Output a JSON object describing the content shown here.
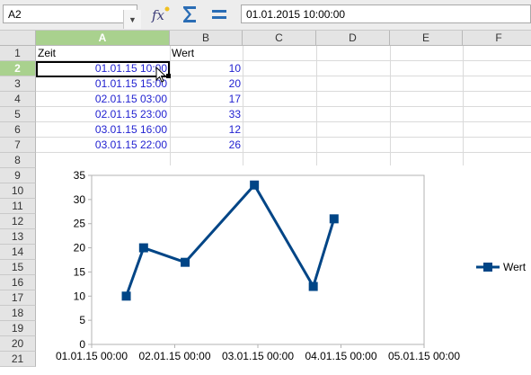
{
  "namebox": {
    "value": "A2"
  },
  "formula_bar": {
    "value": "01.01.2015 10:00:00"
  },
  "toolbar": {
    "fx_icon": "function-wizard-icon",
    "sum_icon": "sum-icon",
    "equals_icon": "equals-icon"
  },
  "columns": [
    "A",
    "B",
    "C",
    "D",
    "E",
    "F"
  ],
  "selected_column": "A",
  "rows": [
    "1",
    "2",
    "3",
    "4",
    "5",
    "6",
    "7",
    "8",
    "9",
    "10",
    "11",
    "12",
    "13",
    "14",
    "15",
    "16",
    "17",
    "18",
    "19",
    "20",
    "21"
  ],
  "selected_row": "2",
  "table": {
    "headers": [
      "Zeit",
      "Wert"
    ],
    "rows": [
      {
        "zeit": "01.01.15 10:00",
        "wert": "10"
      },
      {
        "zeit": "01.01.15 15:00",
        "wert": "20"
      },
      {
        "zeit": "02.01.15 03:00",
        "wert": "17"
      },
      {
        "zeit": "02.01.15 23:00",
        "wert": "33"
      },
      {
        "zeit": "03.01.15 16:00",
        "wert": "12"
      },
      {
        "zeit": "03.01.15 22:00",
        "wert": "26"
      }
    ]
  },
  "colors": {
    "series": "#004586",
    "selected_header": "#a9d18e",
    "number_text": "#1f1fd0"
  },
  "chart_data": {
    "type": "line",
    "series": [
      {
        "name": "Wert",
        "x": [
          "01.01.15 10:00",
          "01.01.15 15:00",
          "02.01.15 03:00",
          "02.01.15 23:00",
          "03.01.15 16:00",
          "03.01.15 22:00"
        ],
        "values": [
          10,
          20,
          17,
          33,
          12,
          26
        ]
      }
    ],
    "x_tick_labels": [
      "01.01.15 00:00",
      "02.01.15 00:00",
      "03.01.15 00:00",
      "04.01.15 00:00",
      "05.01.15 00:00"
    ],
    "y_ticks": [
      0,
      5,
      10,
      15,
      20,
      25,
      30,
      35
    ],
    "xlim": [
      "01.01.15 00:00",
      "05.01.15 00:00"
    ],
    "ylim": [
      0,
      35
    ],
    "legend": "right",
    "grid": false
  }
}
